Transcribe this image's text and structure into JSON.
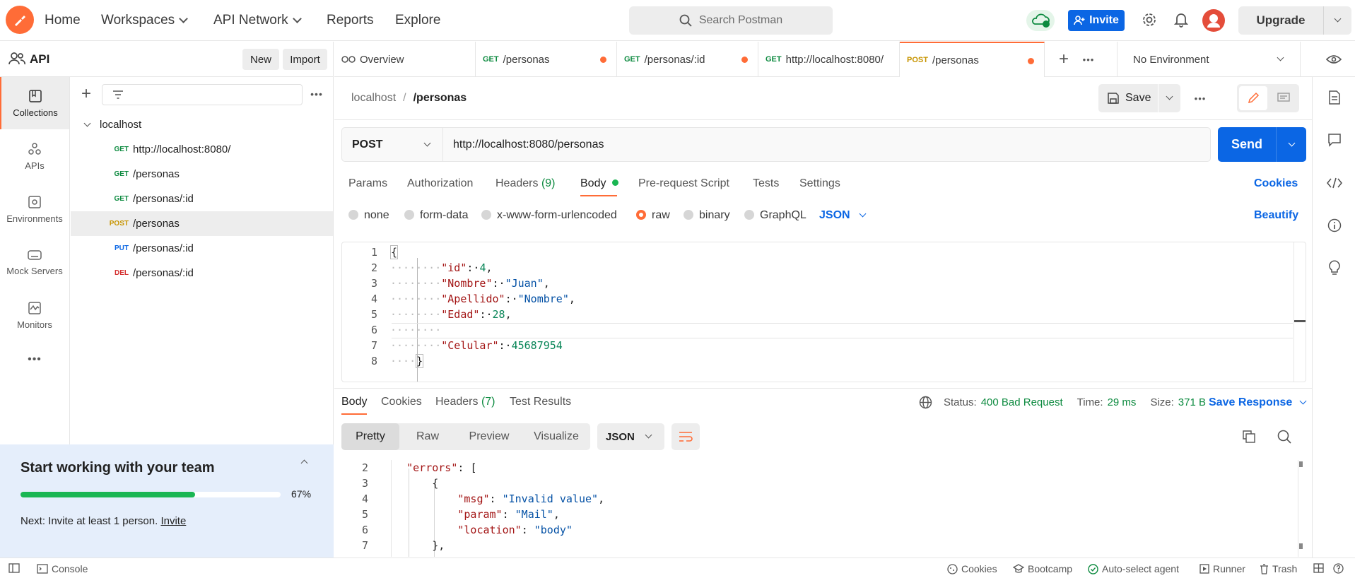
{
  "top_nav": {
    "home": "Home",
    "workspaces": "Workspaces",
    "api_network": "API Network",
    "reports": "Reports",
    "explore": "Explore",
    "search_placeholder": "Search Postman",
    "invite": "Invite",
    "upgrade": "Upgrade"
  },
  "workspace": {
    "name": "API",
    "new_label": "New",
    "import_label": "Import"
  },
  "rail": {
    "collections": "Collections",
    "apis": "APIs",
    "environments": "Environments",
    "mock_servers": "Mock Servers",
    "monitors": "Monitors",
    "more": "•••"
  },
  "tree": {
    "collection": "localhost",
    "items": [
      {
        "method": "GET",
        "path": "http://localhost:8080/"
      },
      {
        "method": "GET",
        "path": "/personas"
      },
      {
        "method": "GET",
        "path": "/personas/:id"
      },
      {
        "method": "POST",
        "path": "/personas"
      },
      {
        "method": "PUT",
        "path": "/personas/:id"
      },
      {
        "method": "DEL",
        "path": "/personas/:id"
      }
    ]
  },
  "onboarding": {
    "title": "Start working with your team",
    "progress": 0.67,
    "percent_label": "67%",
    "next_text": "Next: Invite at least 1 person.",
    "invite_link": "Invite"
  },
  "tabs": [
    {
      "method": "",
      "label": "Overview"
    },
    {
      "method": "GET",
      "label": "/personas"
    },
    {
      "method": "GET",
      "label": "/personas/:id"
    },
    {
      "method": "GET",
      "label": "http://localhost:8080/"
    },
    {
      "method": "POST",
      "label": "/personas"
    }
  ],
  "environment": "No Environment",
  "breadcrumb": {
    "parent": "localhost",
    "separator": "/",
    "current": "/personas"
  },
  "save_label": "Save",
  "request": {
    "method": "POST",
    "url": "http://localhost:8080/personas",
    "send": "Send"
  },
  "request_tabs": {
    "params": "Params",
    "authorization": "Authorization",
    "headers": "Headers",
    "headers_count": "(9)",
    "body": "Body",
    "prerequest": "Pre-request Script",
    "tests": "Tests",
    "settings": "Settings",
    "cookies": "Cookies"
  },
  "body_types": {
    "none": "none",
    "form_data": "form-data",
    "urlencoded": "x-www-form-urlencoded",
    "raw": "raw",
    "binary": "binary",
    "graphql": "GraphQL",
    "format": "JSON",
    "beautify": "Beautify"
  },
  "request_body": {
    "lines": [
      {
        "n": "1",
        "ws": "",
        "key": "",
        "sep": "",
        "val": "",
        "vtype": "",
        "tail": "{"
      },
      {
        "n": "2",
        "ws": "········",
        "key": "\"id\"",
        "sep": ":·",
        "val": "4",
        "vtype": "n",
        "tail": ","
      },
      {
        "n": "3",
        "ws": "········",
        "key": "\"Nombre\"",
        "sep": ":·",
        "val": "\"Juan\"",
        "vtype": "s",
        "tail": ","
      },
      {
        "n": "4",
        "ws": "········",
        "key": "\"Apellido\"",
        "sep": ":·",
        "val": "\"Nombre\"",
        "vtype": "s",
        "tail": ","
      },
      {
        "n": "5",
        "ws": "········",
        "key": "\"Edad\"",
        "sep": ":·",
        "val": "28",
        "vtype": "n",
        "tail": ","
      },
      {
        "n": "6",
        "ws": "········",
        "key": "",
        "sep": "",
        "val": "",
        "vtype": "",
        "tail": ""
      },
      {
        "n": "7",
        "ws": "········",
        "key": "\"Celular\"",
        "sep": ":·",
        "val": "45687954",
        "vtype": "n",
        "tail": ""
      },
      {
        "n": "8",
        "ws": "····",
        "key": "",
        "sep": "",
        "val": "",
        "vtype": "",
        "tail": "}"
      }
    ]
  },
  "response_tabs": {
    "body": "Body",
    "cookies": "Cookies",
    "headers": "Headers",
    "headers_count": "(7)",
    "test_results": "Test Results"
  },
  "response_meta": {
    "status_label": "Status:",
    "status_value": "400 Bad Request",
    "time_label": "Time:",
    "time_value": "29 ms",
    "size_label": "Size:",
    "size_value": "371 B",
    "save_response": "Save Response"
  },
  "response_view": {
    "pretty": "Pretty",
    "raw": "Raw",
    "preview": "Preview",
    "visualize": "Visualize",
    "format": "JSON"
  },
  "response_body": {
    "lines": [
      {
        "n": "2",
        "indent": "    ",
        "key": "\"errors\"",
        "sep": ": ",
        "val": "",
        "vtype": "",
        "tail": "["
      },
      {
        "n": "3",
        "indent": "        ",
        "key": "",
        "sep": "",
        "val": "",
        "vtype": "",
        "tail": "{"
      },
      {
        "n": "4",
        "indent": "            ",
        "key": "\"msg\"",
        "sep": ": ",
        "val": "\"Invalid value\"",
        "vtype": "s",
        "tail": ","
      },
      {
        "n": "5",
        "indent": "            ",
        "key": "\"param\"",
        "sep": ": ",
        "val": "\"Mail\"",
        "vtype": "s",
        "tail": ","
      },
      {
        "n": "6",
        "indent": "            ",
        "key": "\"location\"",
        "sep": ": ",
        "val": "\"body\"",
        "vtype": "s",
        "tail": ""
      },
      {
        "n": "7",
        "indent": "        ",
        "key": "",
        "sep": "",
        "val": "",
        "vtype": "",
        "tail": "},"
      }
    ]
  },
  "status_bar": {
    "console": "Console",
    "cookies": "Cookies",
    "bootcamp": "Bootcamp",
    "auto_select": "Auto-select agent",
    "runner": "Runner",
    "trash": "Trash"
  },
  "colors": {
    "accent": "#ff6c37",
    "primary": "#0b66e4",
    "success": "#0c8a3f"
  }
}
